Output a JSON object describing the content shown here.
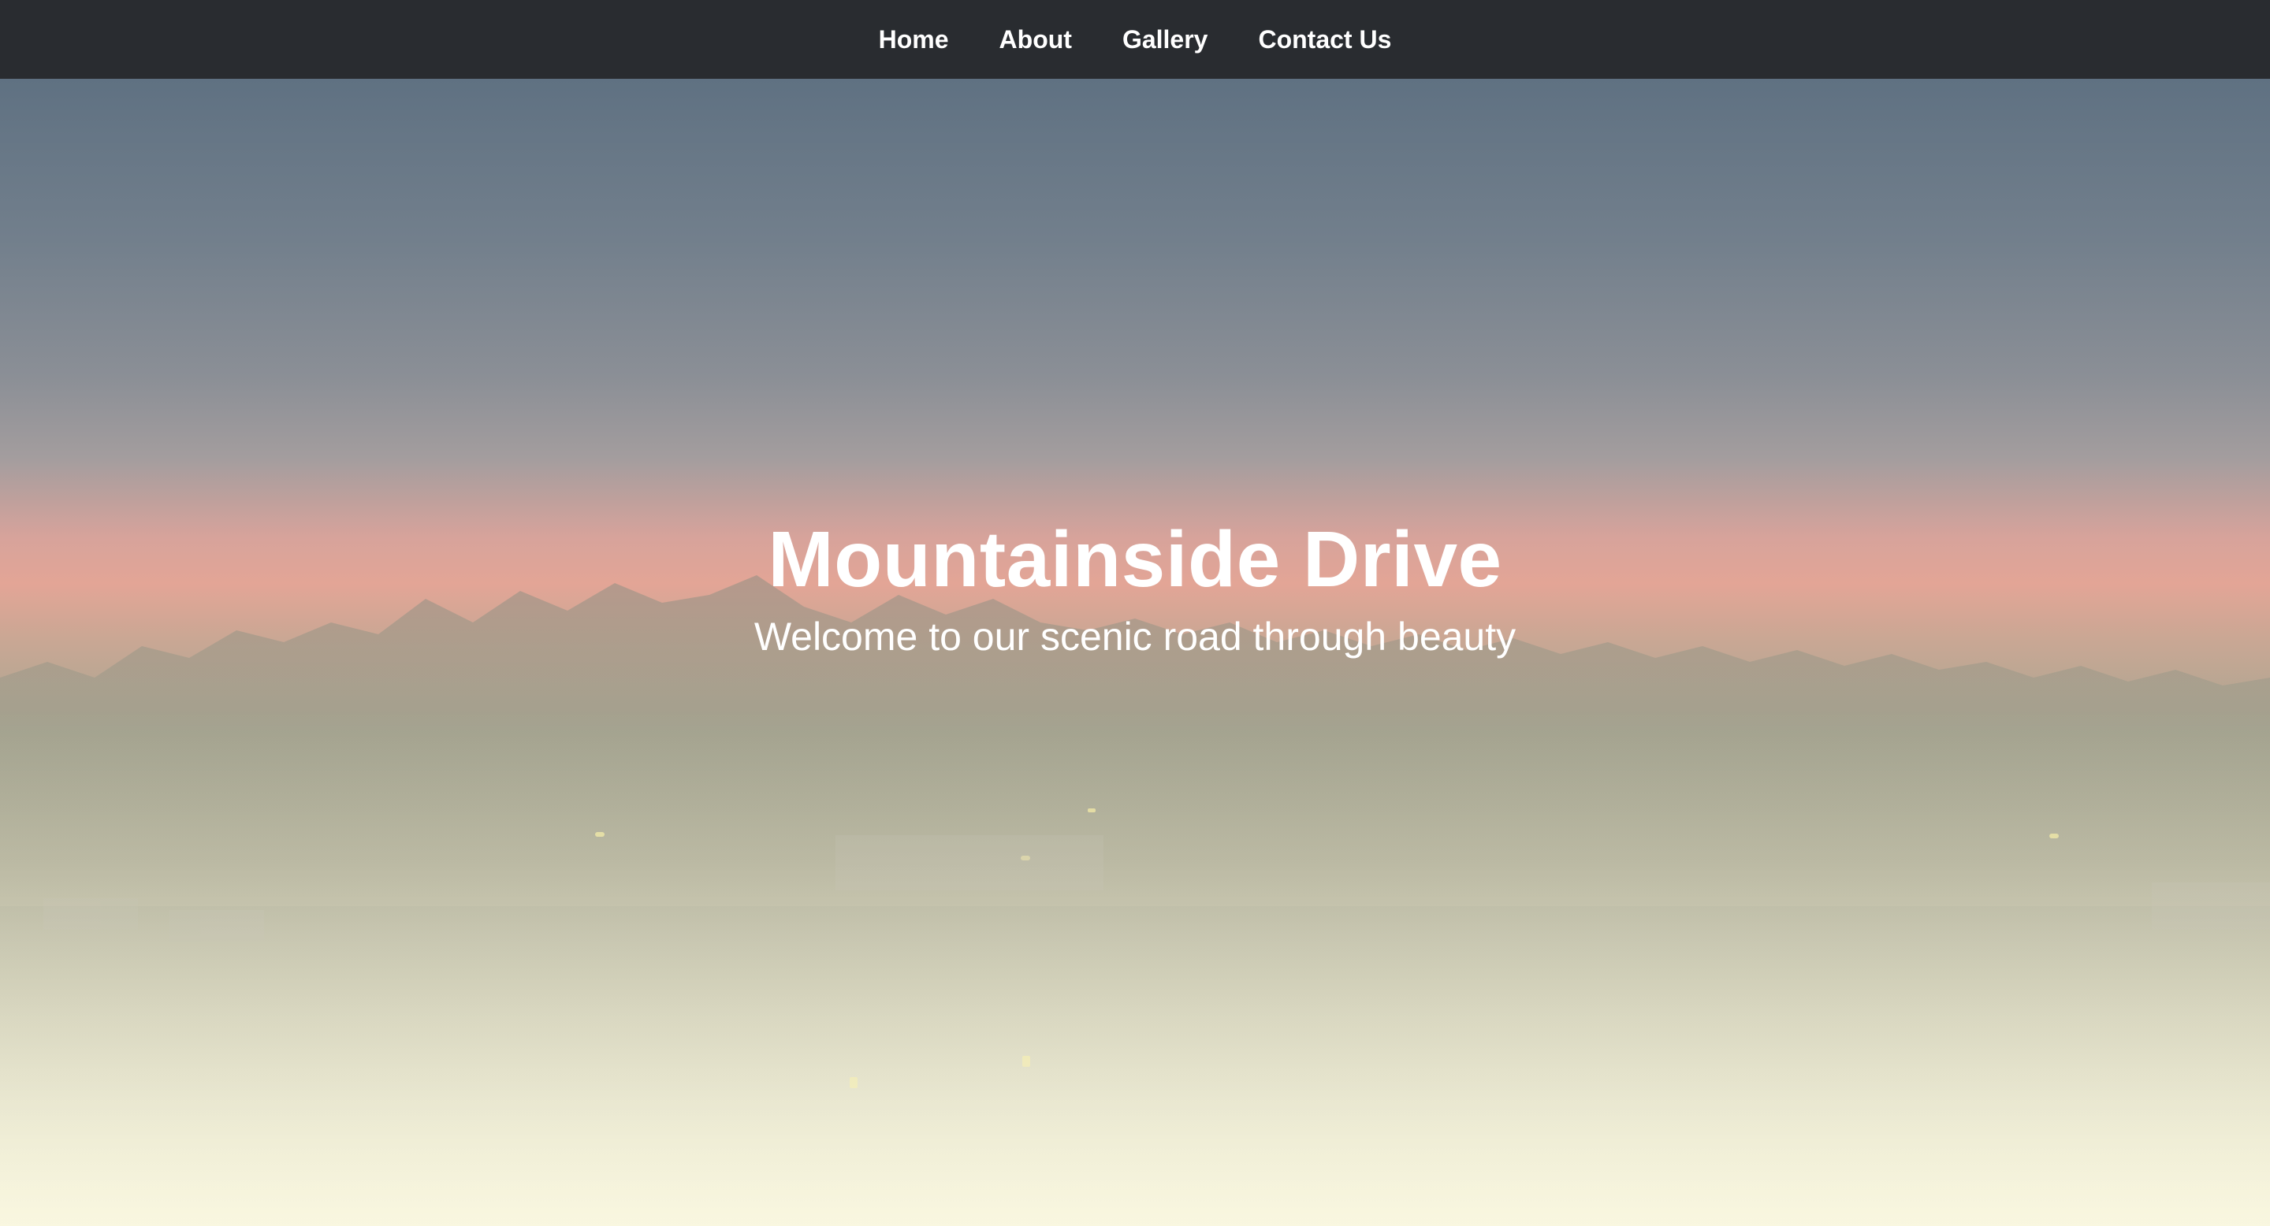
{
  "nav": {
    "items": [
      {
        "label": "Home"
      },
      {
        "label": "About"
      },
      {
        "label": "Gallery"
      },
      {
        "label": "Contact Us"
      }
    ]
  },
  "hero": {
    "title": "Mountainside Drive",
    "subtitle": "Welcome to our scenic road through beauty"
  },
  "colors": {
    "navbar_bg": "#292c30",
    "nav_text": "#ffffff",
    "hero_text": "#ffffff"
  }
}
